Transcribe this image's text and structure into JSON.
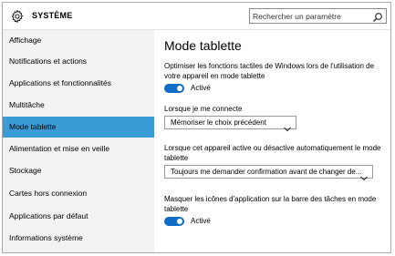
{
  "header": {
    "title": "SYSTÈME",
    "search_placeholder": "Rechercher un paramètre"
  },
  "sidebar": {
    "items": [
      {
        "label": "Affichage"
      },
      {
        "label": "Notifications et actions"
      },
      {
        "label": "Applications et fonctionnalités"
      },
      {
        "label": "Multitâche"
      },
      {
        "label": "Mode tablette",
        "active": true
      },
      {
        "label": "Alimentation et mise en veille"
      },
      {
        "label": "Stockage"
      },
      {
        "label": "Cartes hors connexion"
      },
      {
        "label": "Applications par défaut"
      },
      {
        "label": "Informations système"
      }
    ]
  },
  "main": {
    "title": "Mode tablette",
    "setting1": {
      "description_line1": "Optimiser les fonctions tactiles de Windows lors de l'utilisation de",
      "description_line2": "votre appareil en mode tablette",
      "toggle_state": "Activé"
    },
    "setting2": {
      "label": "Lorsque je me connecte",
      "selected": "Mémoriser le choix précédent"
    },
    "setting3": {
      "label_line1": "Lorsque cet appareil active ou désactive automatiquement le mode",
      "label_line2": "tablette",
      "selected": "Toujours me demander confirmation avant de changer de..."
    },
    "setting4": {
      "description_line1": "Masquer les icônes d'application sur la barre des tâches en mode",
      "description_line2": "tablette",
      "toggle_state": "Activé"
    }
  },
  "colors": {
    "accent": "#3a9bd6",
    "toggle_on": "#0e6cc4",
    "sidebar_bg": "#f2f2f2"
  }
}
